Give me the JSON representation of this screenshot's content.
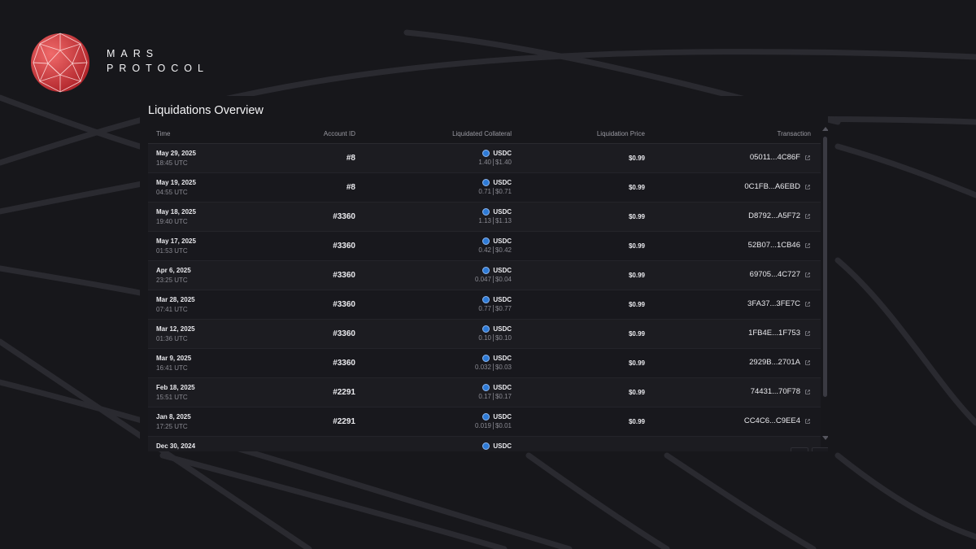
{
  "brand": {
    "line1": "MARS",
    "line2": "PROTOCOL"
  },
  "icons": {
    "logo": "geodesic-sphere-logo",
    "coin": "usdc-coin-icon",
    "link": "external-link-icon"
  },
  "colors": {
    "background": "#17171b",
    "logo_red": "#d93a3e",
    "usdc_blue": "#2d7ad6"
  },
  "panel": {
    "title": "Liquidations Overview",
    "columns": [
      "Time",
      "Account ID",
      "Liquidated Collateral",
      "Liquidation Price",
      "Transaction"
    ],
    "rows": [
      {
        "date": "May 29, 2025",
        "time": "18:45 UTC",
        "account": "#8",
        "asset": "USDC",
        "amount": "1.40",
        "value": "$1.40",
        "price": "$0.99",
        "tx": "05011...4C86F"
      },
      {
        "date": "May 19, 2025",
        "time": "04:55 UTC",
        "account": "#8",
        "asset": "USDC",
        "amount": "0.71",
        "value": "$0.71",
        "price": "$0.99",
        "tx": "0C1FB...A6EBD"
      },
      {
        "date": "May 18, 2025",
        "time": "19:40 UTC",
        "account": "#3360",
        "asset": "USDC",
        "amount": "1.13",
        "value": "$1.13",
        "price": "$0.99",
        "tx": "D8792...A5F72"
      },
      {
        "date": "May 17, 2025",
        "time": "01:53 UTC",
        "account": "#3360",
        "asset": "USDC",
        "amount": "0.42",
        "value": "$0.42",
        "price": "$0.99",
        "tx": "52B07...1CB46"
      },
      {
        "date": "Apr 6, 2025",
        "time": "23:25 UTC",
        "account": "#3360",
        "asset": "USDC",
        "amount": "0.047",
        "value": "$0.04",
        "price": "$0.99",
        "tx": "69705...4C727"
      },
      {
        "date": "Mar 28, 2025",
        "time": "07:41 UTC",
        "account": "#3360",
        "asset": "USDC",
        "amount": "0.77",
        "value": "$0.77",
        "price": "$0.99",
        "tx": "3FA37...3FE7C"
      },
      {
        "date": "Mar 12, 2025",
        "time": "01:36 UTC",
        "account": "#3360",
        "asset": "USDC",
        "amount": "0.10",
        "value": "$0.10",
        "price": "$0.99",
        "tx": "1FB4E...1F753"
      },
      {
        "date": "Mar 9, 2025",
        "time": "16:41 UTC",
        "account": "#3360",
        "asset": "USDC",
        "amount": "0.032",
        "value": "$0.03",
        "price": "$0.99",
        "tx": "2929B...2701A"
      },
      {
        "date": "Feb 18, 2025",
        "time": "15:51 UTC",
        "account": "#2291",
        "asset": "USDC",
        "amount": "0.17",
        "value": "$0.17",
        "price": "$0.99",
        "tx": "74431...70F78"
      },
      {
        "date": "Jan 8, 2025",
        "time": "17:25 UTC",
        "account": "#2291",
        "asset": "USDC",
        "amount": "0.019",
        "value": "$0.01",
        "price": "$0.99",
        "tx": "CC4C6...C9EE4"
      },
      {
        "date": "Dec 30, 2024",
        "time": "",
        "account": "",
        "asset": "USDC",
        "amount": "",
        "value": "",
        "price": "",
        "tx": ""
      }
    ]
  }
}
